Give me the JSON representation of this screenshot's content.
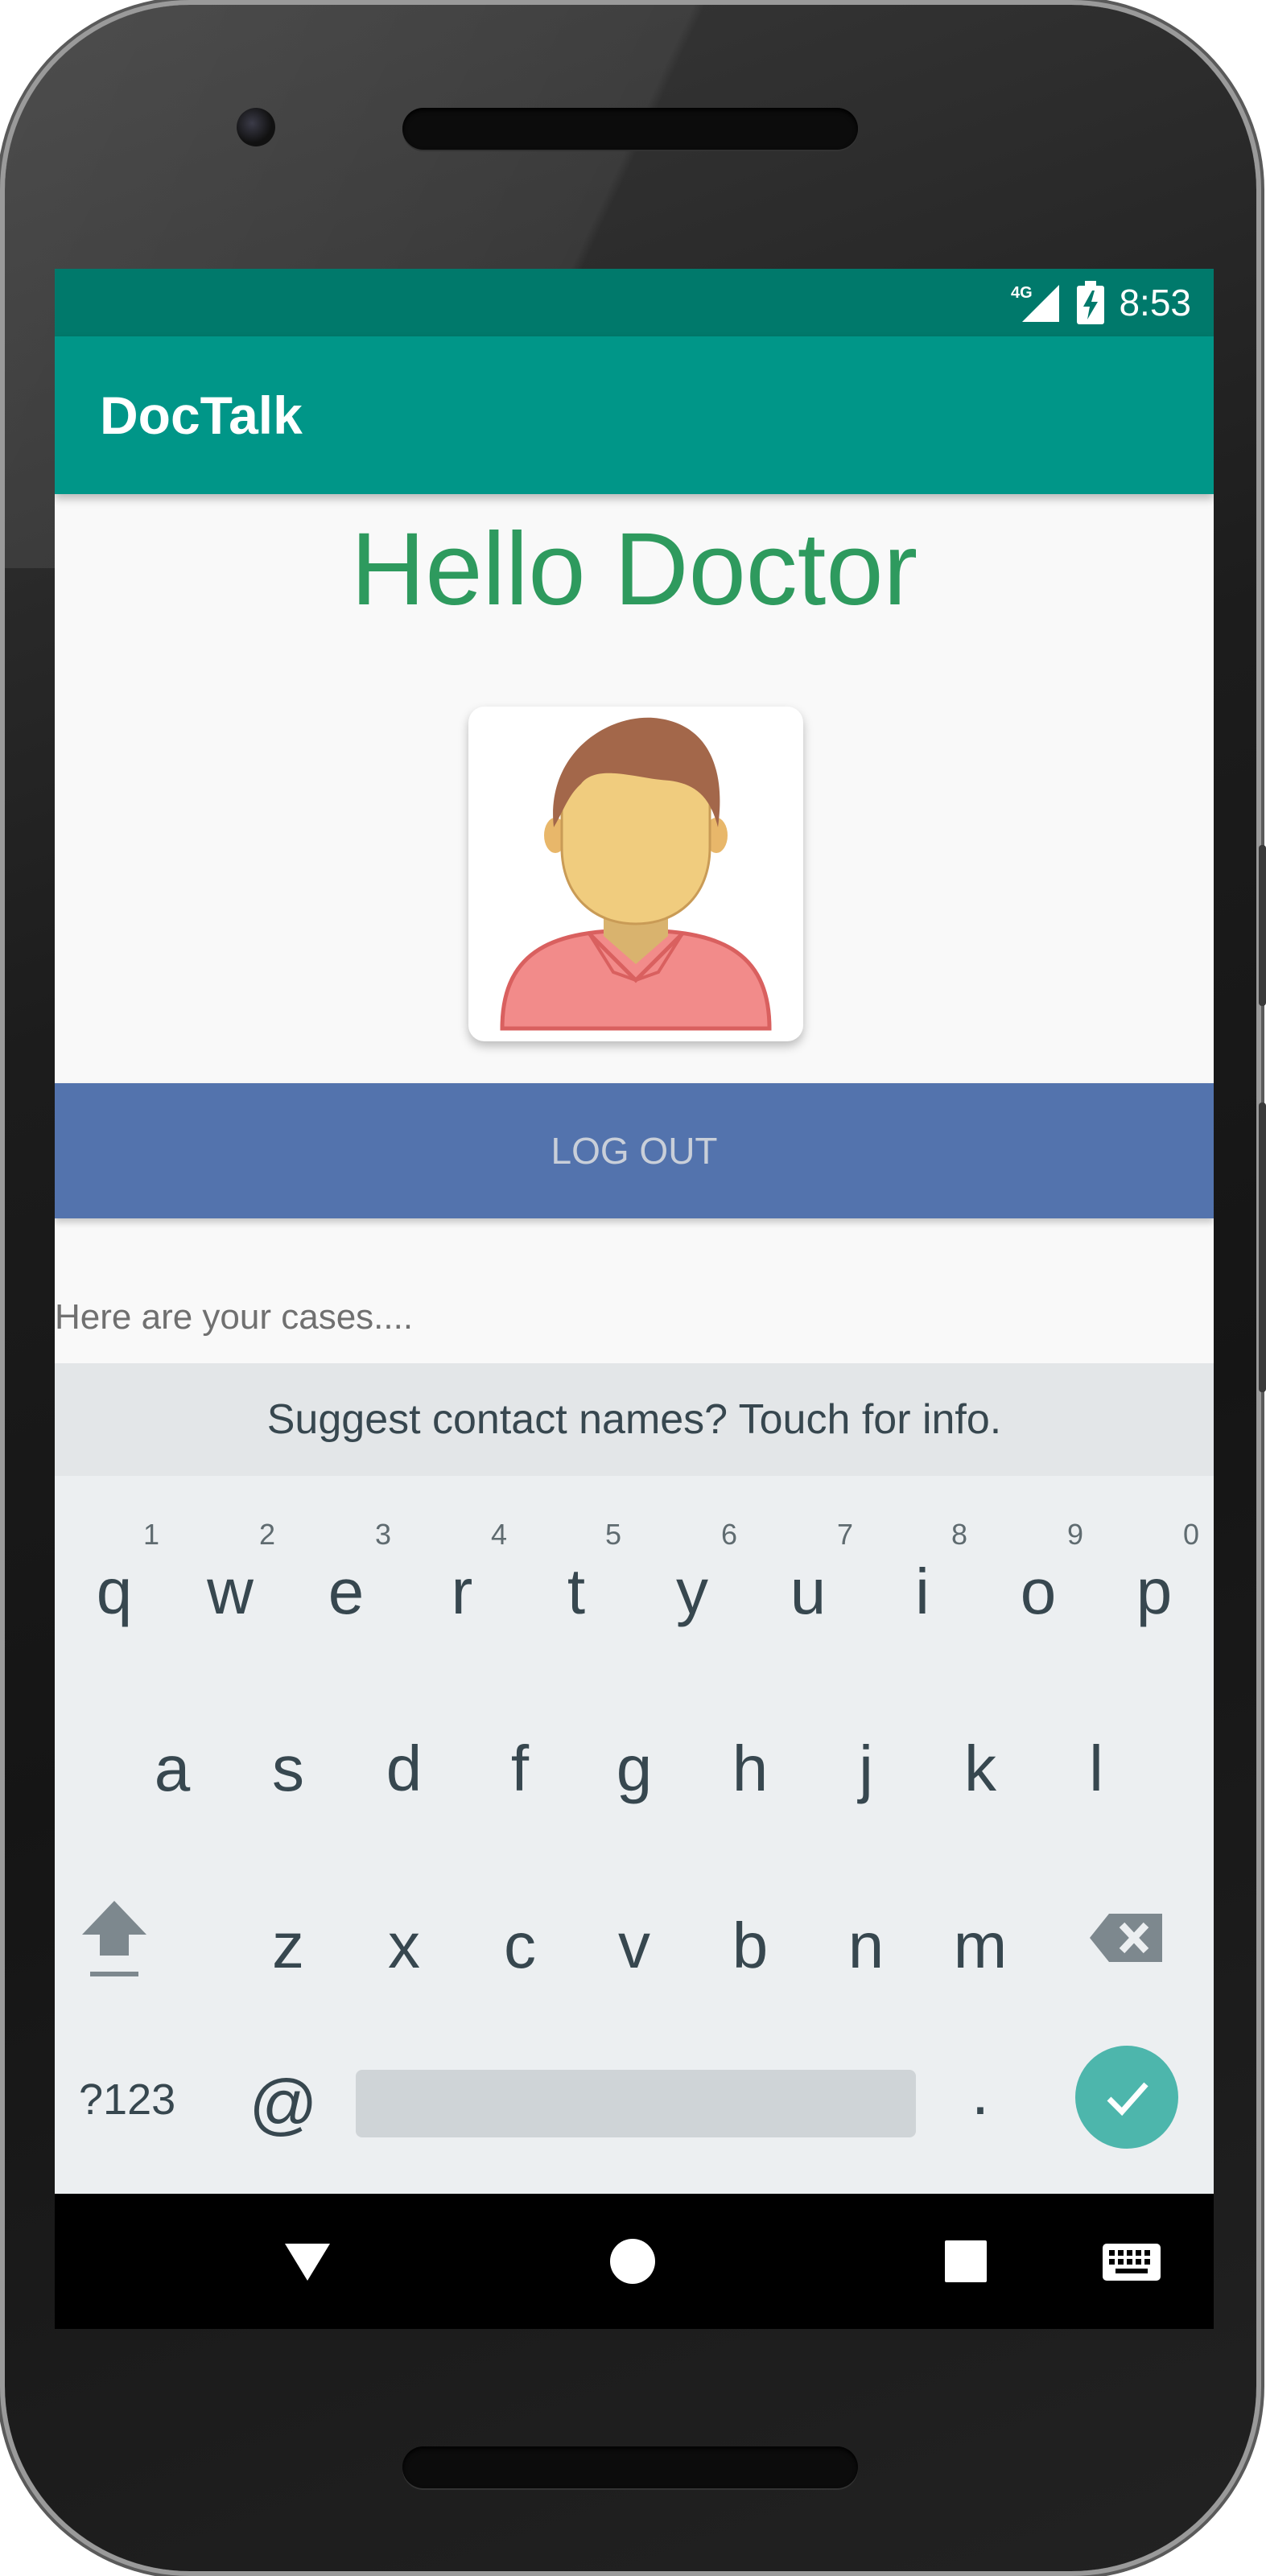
{
  "status_bar": {
    "network": "4G",
    "time": "8:53"
  },
  "app_bar": {
    "title": "DocTalk"
  },
  "main": {
    "greeting": "Hello Doctor",
    "logout_label": "LOG OUT",
    "cases_text": "Here are your cases...."
  },
  "keyboard": {
    "suggestion": "Suggest contact names? Touch for info.",
    "row1": [
      {
        "key": "q",
        "hint": "1"
      },
      {
        "key": "w",
        "hint": "2"
      },
      {
        "key": "e",
        "hint": "3"
      },
      {
        "key": "r",
        "hint": "4"
      },
      {
        "key": "t",
        "hint": "5"
      },
      {
        "key": "y",
        "hint": "6"
      },
      {
        "key": "u",
        "hint": "7"
      },
      {
        "key": "i",
        "hint": "8"
      },
      {
        "key": "o",
        "hint": "9"
      },
      {
        "key": "p",
        "hint": "0"
      }
    ],
    "row2": [
      "a",
      "s",
      "d",
      "f",
      "g",
      "h",
      "j",
      "k",
      "l"
    ],
    "row3": [
      "z",
      "x",
      "c",
      "v",
      "b",
      "n",
      "m"
    ],
    "symbols_label": "?123",
    "at_label": "@",
    "period_label": ".",
    "accent_color": "#4db6ac"
  },
  "colors": {
    "status_bar": "#00796b",
    "app_bar": "#009688",
    "greeting": "#2e9a5e",
    "logout": "#5373ad"
  }
}
